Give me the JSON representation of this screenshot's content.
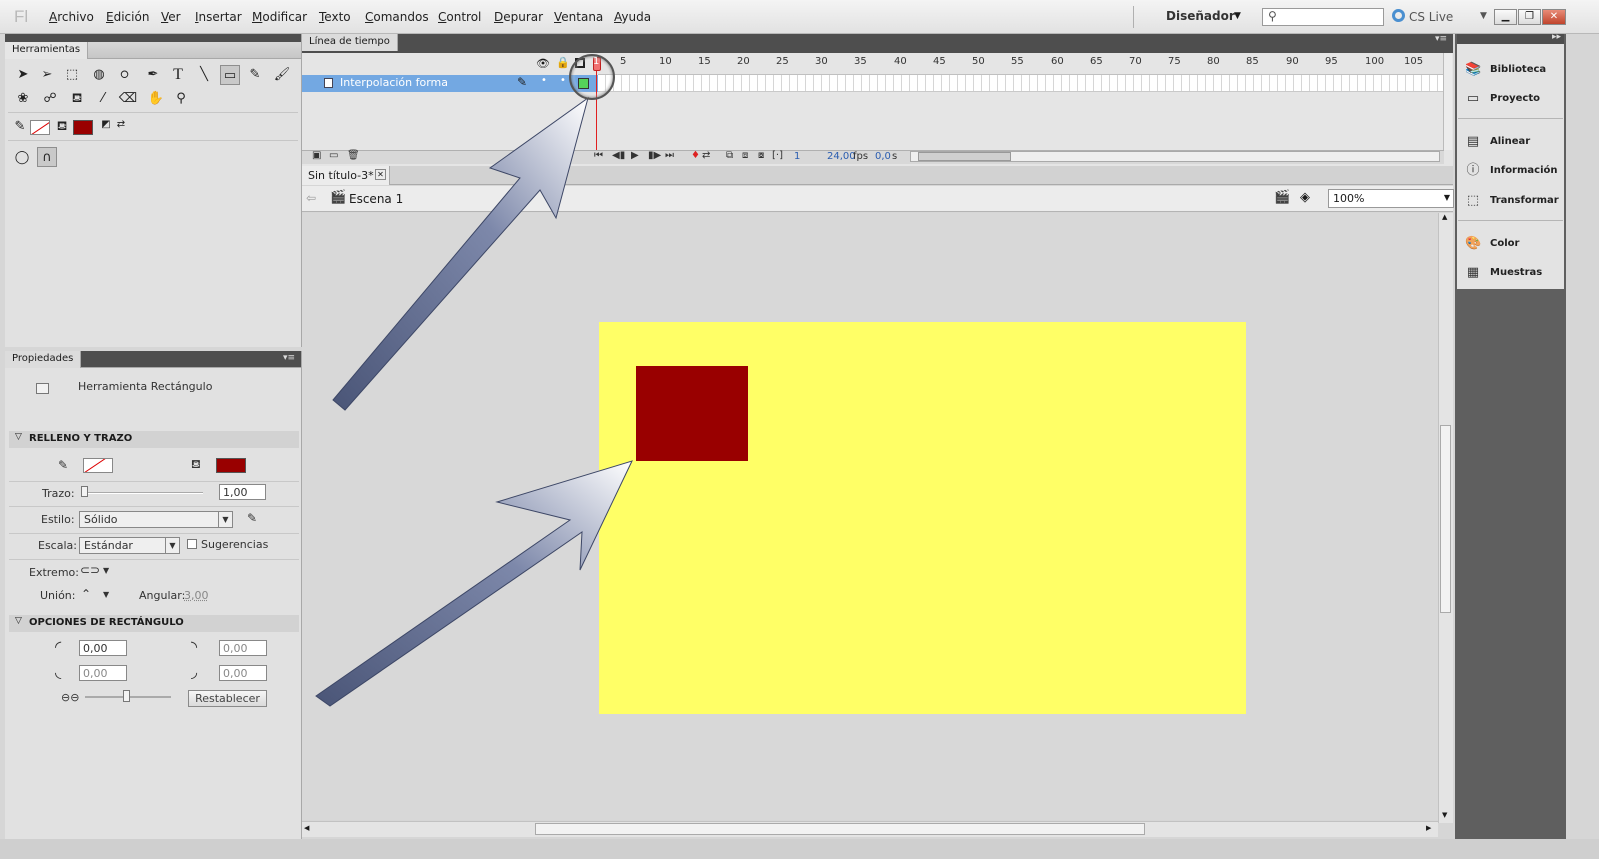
{
  "menu": {
    "app_icon_text": "Fl",
    "items": [
      "Archivo",
      "Edición",
      "Ver",
      "Insertar",
      "Modificar",
      "Texto",
      "Comandos",
      "Control",
      "Depurar",
      "Ventana",
      "Ayuda"
    ]
  },
  "topbar": {
    "workspace": "Diseñador",
    "search_placeholder": "",
    "cslive": "CS Live"
  },
  "tools_panel": {
    "title": "Herramientas"
  },
  "properties": {
    "title": "Propiedades",
    "tool_name": "Herramienta Rectángulo",
    "fill_stroke_section": "RELLENO Y TRAZO",
    "trazo_label": "Trazo:",
    "trazo_value": "1,00",
    "estilo_label": "Estilo:",
    "estilo_value": "Sólido",
    "escala_label": "Escala:",
    "escala_value": "Estándar",
    "sugerencias_label": "Sugerencias",
    "extremo_label": "Extremo:",
    "union_label": "Unión:",
    "angular_label": "Angular:",
    "angular_value": "3,00",
    "rect_section": "OPCIONES DE RECTÁNGULO",
    "corners": [
      "0,00",
      "0,00",
      "0,00",
      "0,00"
    ],
    "reset_button": "Restablecer",
    "fill_color": "#990000"
  },
  "timeline": {
    "title": "Línea de tiempo",
    "layer_name": "Interpolación forma",
    "ruler_ticks": [
      "1",
      "5",
      "10",
      "15",
      "20",
      "25",
      "30",
      "35",
      "40",
      "45",
      "50",
      "55",
      "60",
      "65",
      "70",
      "75",
      "80",
      "85",
      "90",
      "95",
      "100",
      "105"
    ],
    "current_frame": "1",
    "fps": "24,00",
    "fps_unit": "fps",
    "time": "0,0",
    "time_unit": "s"
  },
  "document": {
    "tab_title": "Sin título-3*",
    "scene": "Escena 1",
    "zoom": "100%",
    "stage_color": "#ffff66",
    "rect_color": "#990000"
  },
  "right_dock": {
    "items": [
      "Biblioteca",
      "Proyecto",
      "Alinear",
      "Información",
      "Transformar",
      "Color",
      "Muestras"
    ]
  }
}
